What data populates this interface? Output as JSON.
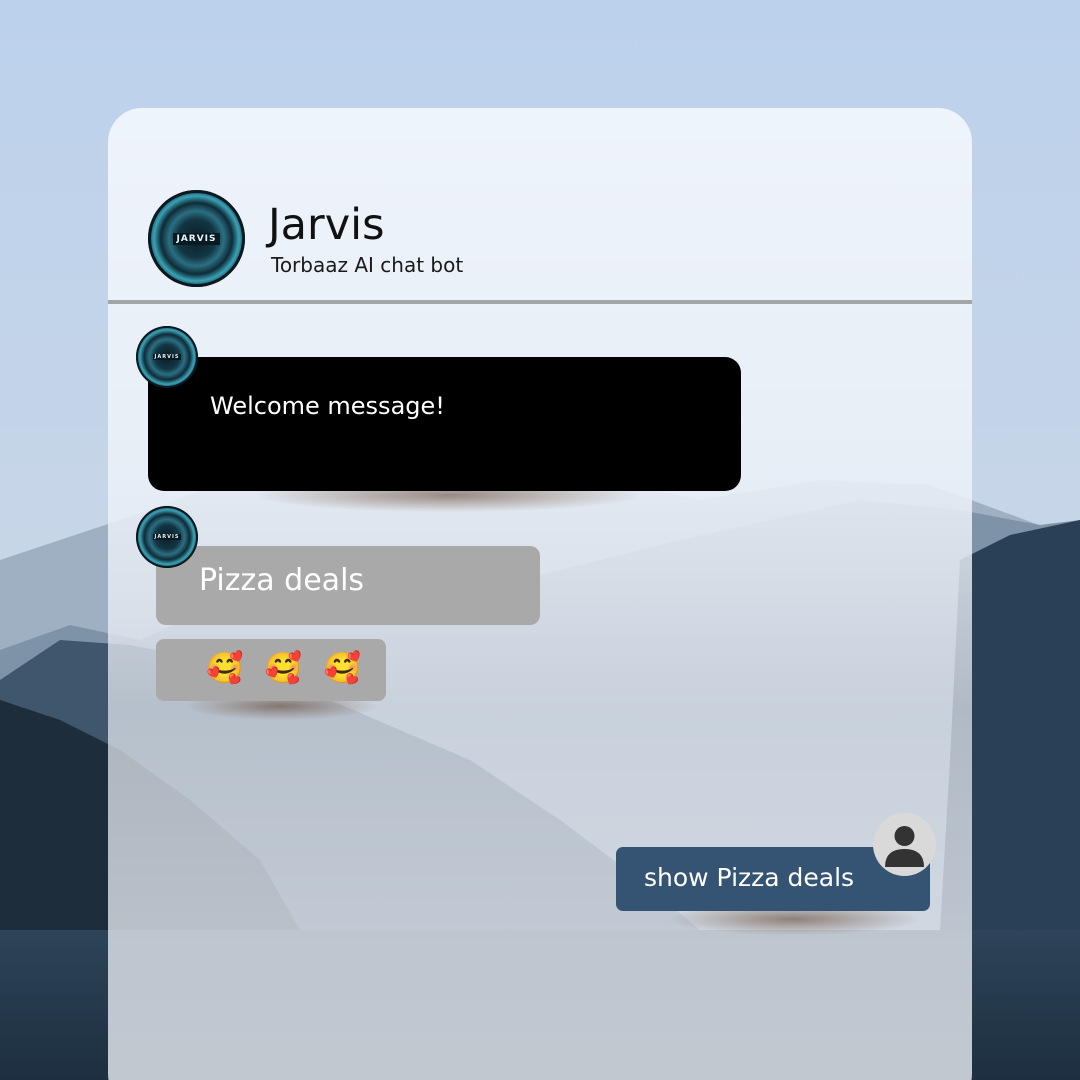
{
  "bot": {
    "name": "Jarvis",
    "subtitle": "Torbaaz AI chat bot",
    "logo_text": "JARVIS"
  },
  "messages": [
    {
      "from": "bot",
      "text": "Welcome message!",
      "style": "black"
    },
    {
      "from": "bot",
      "text": "Pizza deals",
      "style": "gray"
    },
    {
      "from": "bot",
      "text": "🥰 🥰 🥰",
      "style": "gray"
    },
    {
      "from": "user",
      "text": "show Pizza deals",
      "style": "navy"
    }
  ],
  "icons": {
    "bot_avatar": "jarvis-logo-icon",
    "user_avatar": "user-silhouette-icon"
  },
  "colors": {
    "welcome_bubble": "#000000",
    "bot_bubble": "#a9a9a9",
    "user_bubble": "#355473",
    "divider": "#a3a6a9"
  }
}
